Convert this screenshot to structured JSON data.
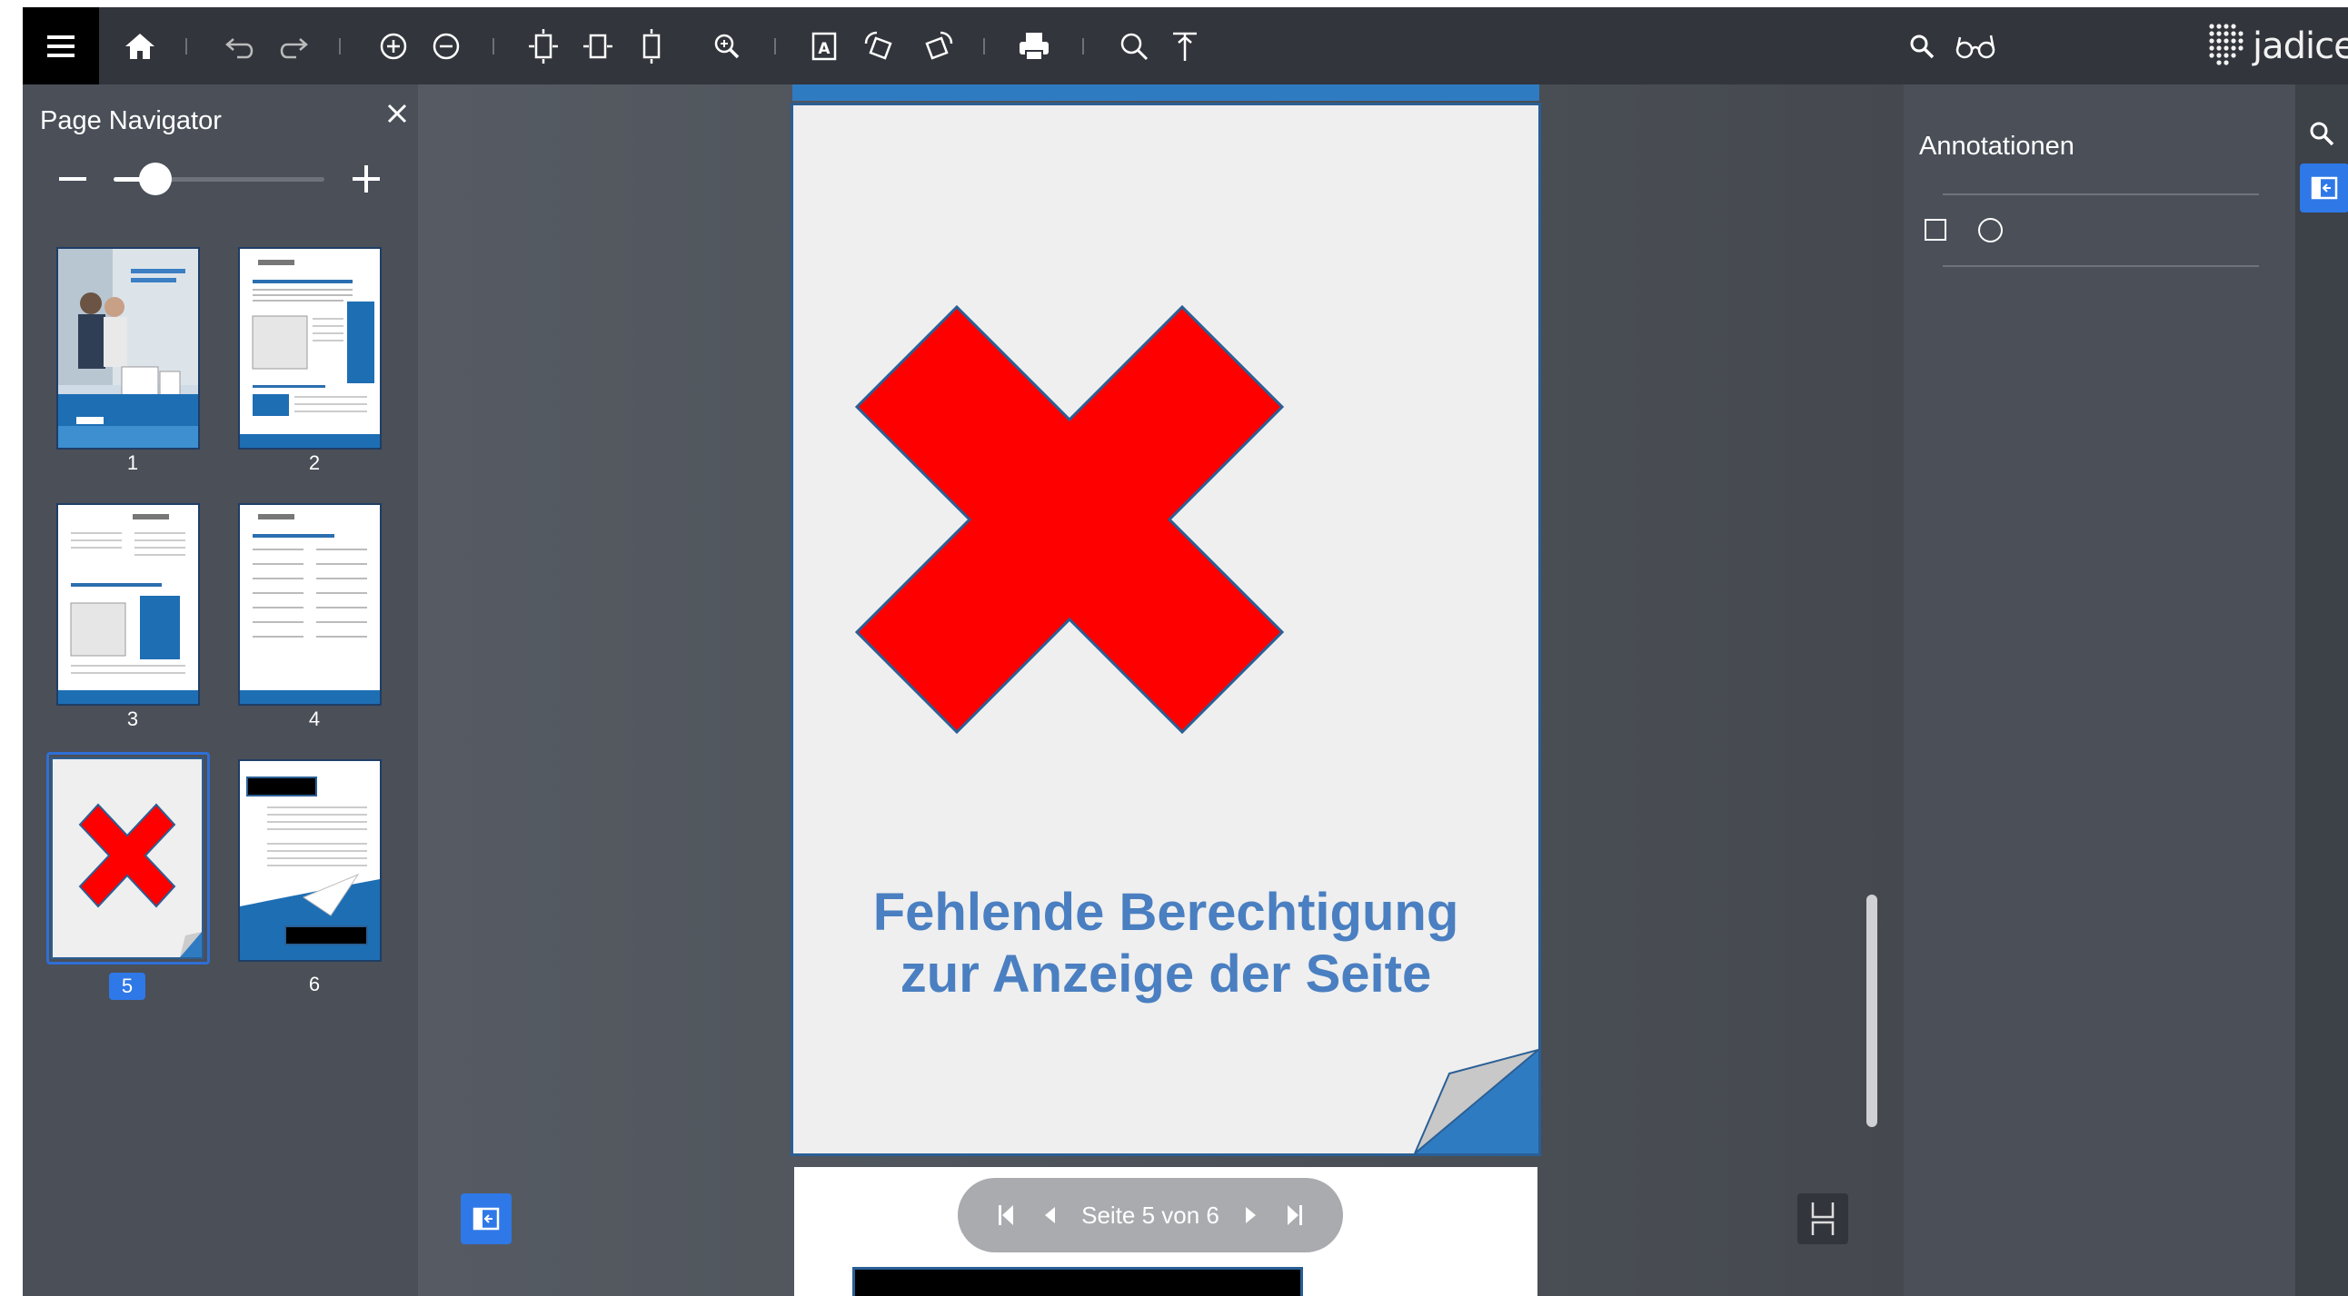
{
  "toolbar": {
    "icons": [
      "menu-icon",
      "home-icon",
      "undo-icon",
      "redo-icon",
      "zoom-in-icon",
      "zoom-out-icon",
      "fit-page-icon",
      "fit-width-icon",
      "fit-height-icon",
      "zoom-tool-icon",
      "ocr-icon",
      "rotate-left-icon",
      "rotate-right-icon",
      "print-icon",
      "search-icon",
      "pointer-icon",
      "search-icon",
      "glasses-icon"
    ],
    "brand": "jadice"
  },
  "navigator": {
    "title": "Page Navigator",
    "zoom_level": 0.2,
    "pages": [
      {
        "number": "1"
      },
      {
        "number": "2"
      },
      {
        "number": "3"
      },
      {
        "number": "4"
      },
      {
        "number": "5",
        "selected": true
      },
      {
        "number": "6"
      }
    ]
  },
  "viewer": {
    "message_line1": "Fehlende Berechtigung",
    "message_line2": "zur Anzeige der Seite",
    "pager_text": "Seite 5 von 6"
  },
  "annotations": {
    "title": "Annotationen",
    "tools": [
      "rectangle-tool-icon",
      "ellipse-tool-icon"
    ]
  },
  "colors": {
    "accent": "#2f78e8",
    "error_cross": "#ff0000",
    "message_text": "#4a7fc1",
    "toolbar_bg": "#32353b"
  }
}
